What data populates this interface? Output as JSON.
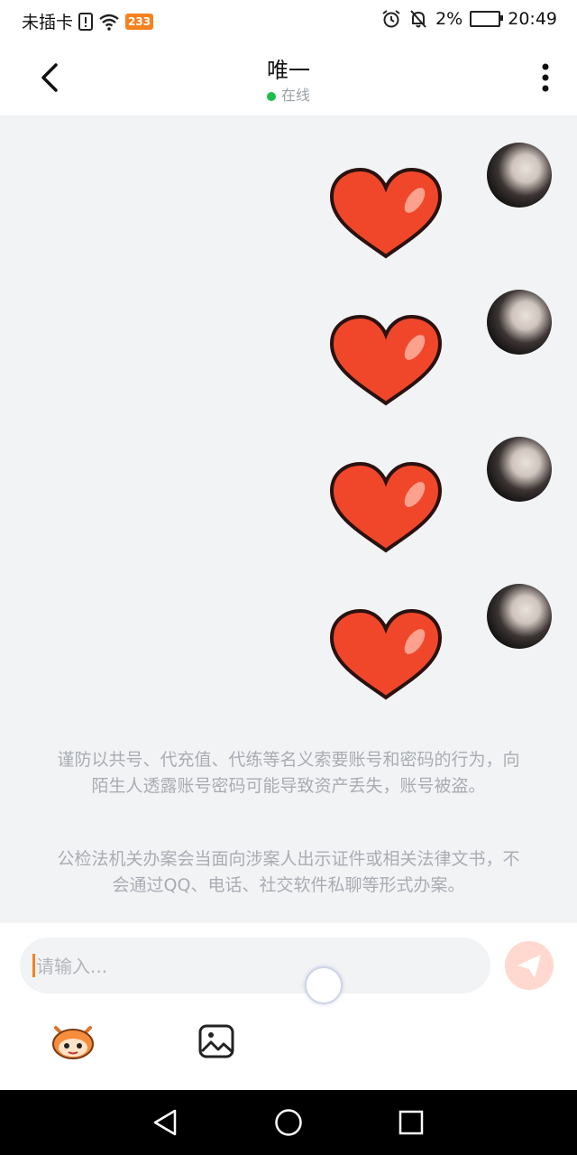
{
  "status_bar": {
    "carrier": "未插卡",
    "badge": "233",
    "battery": "2%",
    "time": "20:49"
  },
  "header": {
    "title": "唯一",
    "presence": "在线"
  },
  "messages": [
    {
      "type": "sticker",
      "icon": "heart-sticker",
      "sender": "self"
    },
    {
      "type": "sticker",
      "icon": "heart-sticker",
      "sender": "self"
    },
    {
      "type": "sticker",
      "icon": "heart-sticker",
      "sender": "self"
    },
    {
      "type": "sticker",
      "icon": "heart-sticker",
      "sender": "self"
    }
  ],
  "notices": [
    "谨防以共号、代充值、代练等名义索要账号和密码的行为，向陌生人透露账号密码可能导致资产丢失，账号被盗。",
    "公检法机关办案会当面向涉案人出示证件或相关法律文书，不会通过QQ、电话、社交软件私聊等形式办案。"
  ],
  "composer": {
    "placeholder": "请输入..."
  },
  "colors": {
    "accent": "#f5821f",
    "online": "#1fbf4a",
    "heart": "#f0472a"
  }
}
